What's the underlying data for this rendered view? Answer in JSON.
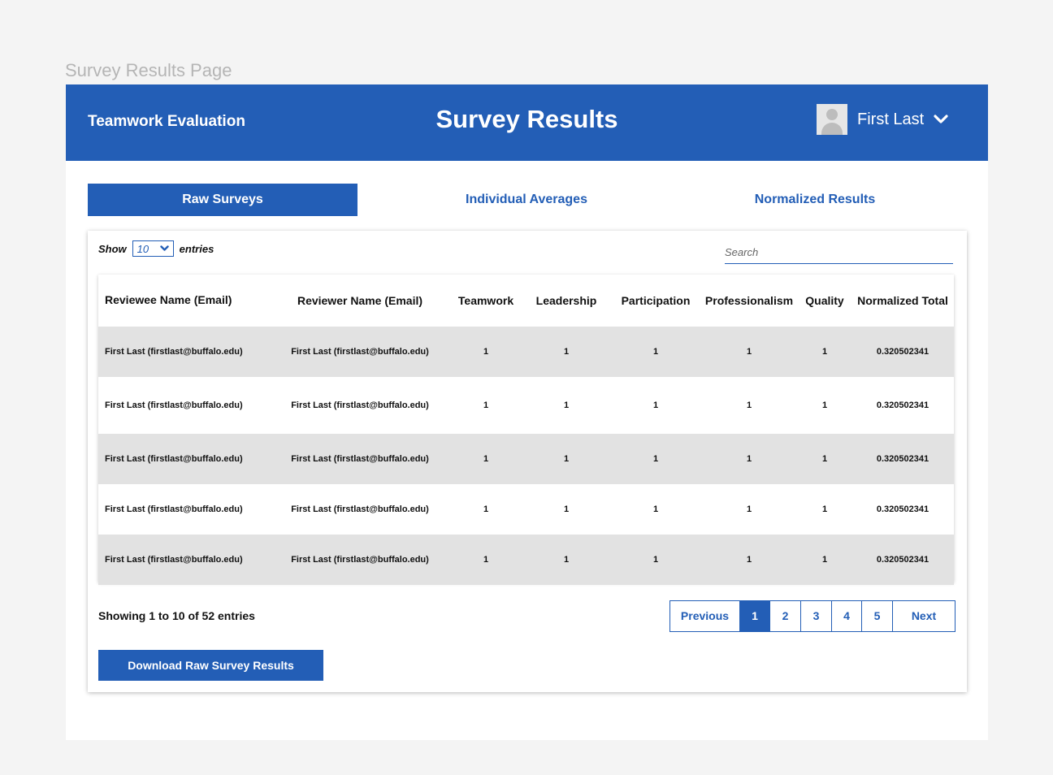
{
  "frame_label": "Survey Results Page",
  "header": {
    "app_name": "Teamwork Evaluation",
    "page_title": "Survey Results",
    "user_name": "First Last"
  },
  "tabs": [
    {
      "label": "Raw Surveys",
      "active": true
    },
    {
      "label": "Individual Averages",
      "active": false
    },
    {
      "label": "Normalized Results",
      "active": false
    }
  ],
  "table_controls": {
    "show_label": "Show",
    "entries_value": "10",
    "entries_label": "entries",
    "search_placeholder": "Search"
  },
  "table": {
    "columns": [
      "Reviewee Name (Email)",
      "Reviewer Name (Email)",
      "Teamwork",
      "Leadership",
      "Participation",
      "Professionalism",
      "Quality",
      "Normalized Total"
    ],
    "rows": [
      [
        "First Last (firstlast@buffalo.edu)",
        "First Last (firstlast@buffalo.edu)",
        "1",
        "1",
        "1",
        "1",
        "1",
        "0.320502341"
      ],
      [
        "First Last (firstlast@buffalo.edu)",
        "First Last (firstlast@buffalo.edu)",
        "1",
        "1",
        "1",
        "1",
        "1",
        "0.320502341"
      ],
      [
        "First Last (firstlast@buffalo.edu)",
        "First Last (firstlast@buffalo.edu)",
        "1",
        "1",
        "1",
        "1",
        "1",
        "0.320502341"
      ],
      [
        "First Last (firstlast@buffalo.edu)",
        "First Last (firstlast@buffalo.edu)",
        "1",
        "1",
        "1",
        "1",
        "1",
        "0.320502341"
      ],
      [
        "First Last (firstlast@buffalo.edu)",
        "First Last (firstlast@buffalo.edu)",
        "1",
        "1",
        "1",
        "1",
        "1",
        "0.320502341"
      ]
    ]
  },
  "footer": {
    "summary": "Showing 1 to 10 of 52 entries",
    "pagination": [
      "Previous",
      "1",
      "2",
      "3",
      "4",
      "5",
      "Next"
    ],
    "current_page": "1",
    "download_label": "Download Raw Survey Results"
  },
  "colors": {
    "primary": "#235eb6",
    "row_shade": "#e2e2e2",
    "background": "#f4f4f4"
  }
}
